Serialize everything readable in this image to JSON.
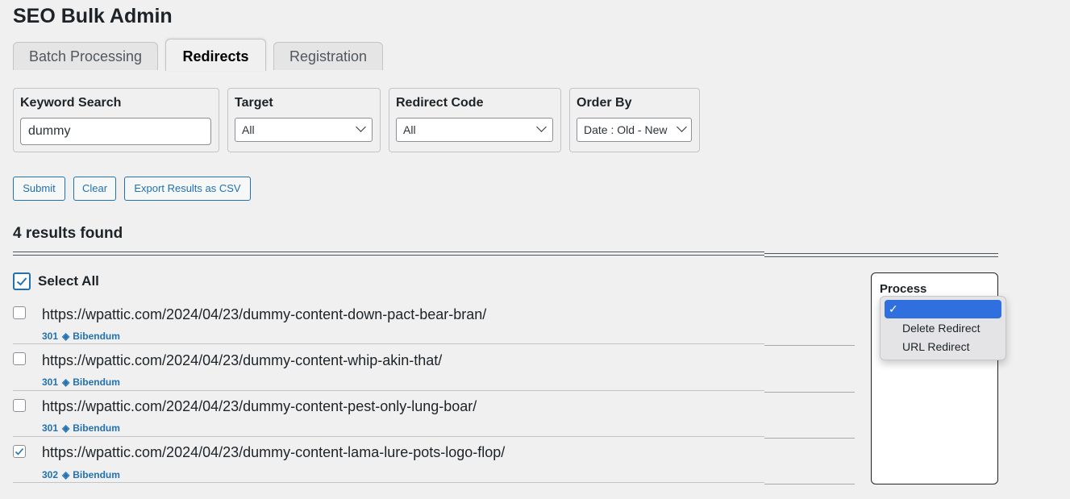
{
  "page": {
    "title": "SEO Bulk Admin"
  },
  "tabs": [
    {
      "label": "Batch Processing",
      "active": false
    },
    {
      "label": "Redirects",
      "active": true
    },
    {
      "label": "Registration",
      "active": false
    }
  ],
  "filters": {
    "keyword": {
      "label": "Keyword Search",
      "value": "dummy"
    },
    "target": {
      "label": "Target",
      "selected": "All"
    },
    "redirect_code": {
      "label": "Redirect Code",
      "selected": "All"
    },
    "order_by": {
      "label": "Order By",
      "selected": "Date : Old - New"
    }
  },
  "buttons": {
    "submit": "Submit",
    "clear": "Clear",
    "export": "Export Results as CSV"
  },
  "results": {
    "count_text": "4 results found",
    "select_all_label": "Select All",
    "select_all_checked": true,
    "rows": [
      {
        "url": "https://wpattic.com/2024/04/23/dummy-content-down-pact-bear-bran/",
        "code": "301",
        "separator": "◈",
        "target": "Bibendum",
        "checked": false
      },
      {
        "url": "https://wpattic.com/2024/04/23/dummy-content-whip-akin-that/",
        "code": "301",
        "separator": "◈",
        "target": "Bibendum",
        "checked": false
      },
      {
        "url": "https://wpattic.com/2024/04/23/dummy-content-pest-only-lung-boar/",
        "code": "301",
        "separator": "◈",
        "target": "Bibendum",
        "checked": false
      },
      {
        "url": "https://wpattic.com/2024/04/23/dummy-content-lama-lure-pots-logo-flop/",
        "code": "302",
        "separator": "◈",
        "target": "Bibendum",
        "checked": true
      }
    ]
  },
  "process": {
    "label": "Process",
    "options": [
      {
        "label": "",
        "selected": true,
        "check": "✓"
      },
      {
        "label": "Delete Redirect",
        "selected": false
      },
      {
        "label": "URL Redirect",
        "selected": false
      }
    ]
  },
  "colors": {
    "accent": "#2271b1",
    "highlight": "#2f6fde",
    "text": "#1d2327"
  }
}
